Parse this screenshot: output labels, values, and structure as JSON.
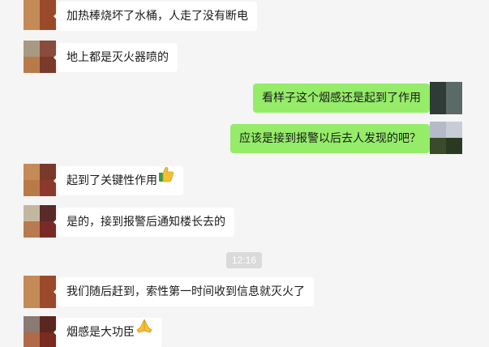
{
  "messages": [
    {
      "side": "in",
      "text": "加热棒烧坏了水桶，人走了没有断电",
      "emoji": "",
      "avatar": [
        "#c48a57",
        "#9a4a2a",
        "#c48a57",
        "#9a4a2a"
      ]
    },
    {
      "side": "in",
      "text": "地上都是灭火器喷的",
      "emoji": "",
      "avatar": [
        "#a89a82",
        "#8a4a3e",
        "#b97a4a",
        "#7a3a2a"
      ]
    },
    {
      "side": "out",
      "text": "看样子这个烟感还是起到了作用",
      "emoji": "",
      "avatar": [
        "#2f3b36",
        "#5a6a66",
        "#2f3b36",
        "#5a6a66"
      ]
    },
    {
      "side": "out",
      "text": "应该是接到报警以后去人发现的吧？",
      "emoji": "",
      "avatar": [
        "#b4bac8",
        "#c8ccd6",
        "#3a4a2a",
        "#2a3a22"
      ]
    },
    {
      "side": "in",
      "text": "起到了关键性作用",
      "emoji": "thumbs-up",
      "avatar": [
        "#c48a57",
        "#7a3a2a",
        "#b97a4a",
        "#8a3a2a"
      ]
    },
    {
      "side": "in",
      "text": "是的，接到报警后通知楼长去的",
      "emoji": "",
      "avatar": [
        "#c2b8a0",
        "#5a2a28",
        "#b87a50",
        "#7a2a24"
      ]
    },
    {
      "side": "in",
      "text": "我们随后赶到，索性第一时间收到信息就灭火了",
      "emoji": "",
      "avatar": [
        "#c48a57",
        "#9a4a2a",
        "#c48a57",
        "#9a4a2a"
      ]
    },
    {
      "side": "in",
      "text": "烟感是大功臣",
      "emoji": "folded-hands",
      "avatar": [
        "#8a7a72",
        "#5a2620",
        "#b06a48",
        "#7a2a1e"
      ]
    }
  ],
  "timestamp": "12:16",
  "colors": {
    "incoming_bubble": "#ffffff",
    "outgoing_bubble": "#95ec69",
    "background": "#f5f5f5"
  }
}
